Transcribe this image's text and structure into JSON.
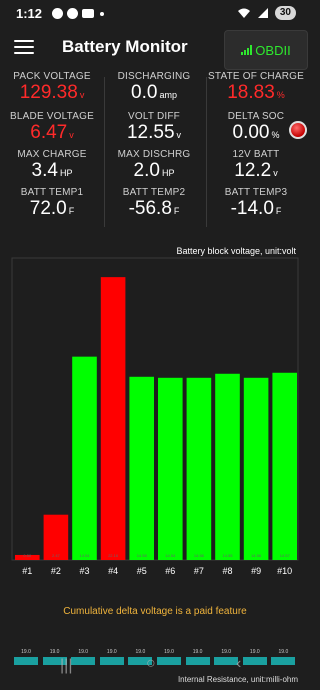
{
  "status_bar": {
    "time": "1:12",
    "battery_level": "30"
  },
  "app_bar": {
    "title": "Battery Monitor",
    "obd_label": "OBDII",
    "obd_color": "#2ee82e"
  },
  "metrics": [
    {
      "label": "PACK VOLTAGE",
      "value": "129.38",
      "unit": "v",
      "color": "red"
    },
    {
      "label": "DISCHARGING",
      "value": "0.0",
      "unit": "amp",
      "color": "white"
    },
    {
      "label": "STATE OF CHARGE",
      "value": "18.83",
      "unit": "%",
      "color": "red"
    },
    {
      "label": "BLADE VOLTAGE",
      "value": "6.47",
      "unit": "v",
      "color": "red"
    },
    {
      "label": "VOLT DIFF",
      "value": "12.55",
      "unit": "v",
      "color": "white"
    },
    {
      "label": "DELTA SOC",
      "value": "0.00",
      "unit": "%",
      "color": "white"
    },
    {
      "label": "MAX CHARGE",
      "value": "3.4",
      "unit": "HP",
      "color": "white"
    },
    {
      "label": "MAX DISCHRG",
      "value": "2.0",
      "unit": "HP",
      "color": "white"
    },
    {
      "label": "12V BATT",
      "value": "12.2",
      "unit": "v",
      "color": "white"
    },
    {
      "label": "BATT TEMP1",
      "value": "72.0",
      "unit": "F",
      "color": "white"
    },
    {
      "label": "BATT TEMP2",
      "value": "-56.8",
      "unit": "F",
      "color": "white"
    },
    {
      "label": "BATT TEMP3",
      "value": "-14.0",
      "unit": "F",
      "color": "white"
    }
  ],
  "colors": {
    "red": "#ff2a2a",
    "green": "#00ff00",
    "bar_red": "#ff0000",
    "accent_note": "#f0b43c",
    "teal": "#1aa0a0"
  },
  "chart_data": {
    "type": "bar",
    "title": "Battery block voltage, unit:volt",
    "categories": [
      "#1",
      "#2",
      "#3",
      "#4",
      "#5",
      "#6",
      "#7",
      "#8",
      "#9",
      "#10"
    ],
    "values": [
      0.5,
      4.5,
      20.2,
      28.1,
      18.2,
      18.1,
      18.1,
      18.5,
      18.1,
      18.6
    ],
    "value_labels": [
      "0.50",
      "2.47",
      "14.04",
      "22.16",
      "14.58",
      "14.54",
      "14.56",
      "14.55",
      "14.56",
      "14.57"
    ],
    "bar_colors": [
      "#ff0000",
      "#ff0000",
      "#00ff00",
      "#ff0000",
      "#00ff00",
      "#00ff00",
      "#00ff00",
      "#00ff00",
      "#00ff00",
      "#00ff00"
    ],
    "ylim": [
      0,
      30
    ]
  },
  "paid_note": "Cumulative delta voltage is a paid feature",
  "mini_chart": {
    "values": [
      "19.0",
      "19.0",
      "19.0",
      "19.0",
      "19.0",
      "19.0",
      "19.0",
      "19.0",
      "19.0",
      "19.0"
    ],
    "caption": "Internal Resistance, unit:milli-ohm"
  },
  "nav_icons": [
    "recent-apps-icon",
    "home-icon",
    "back-icon"
  ]
}
